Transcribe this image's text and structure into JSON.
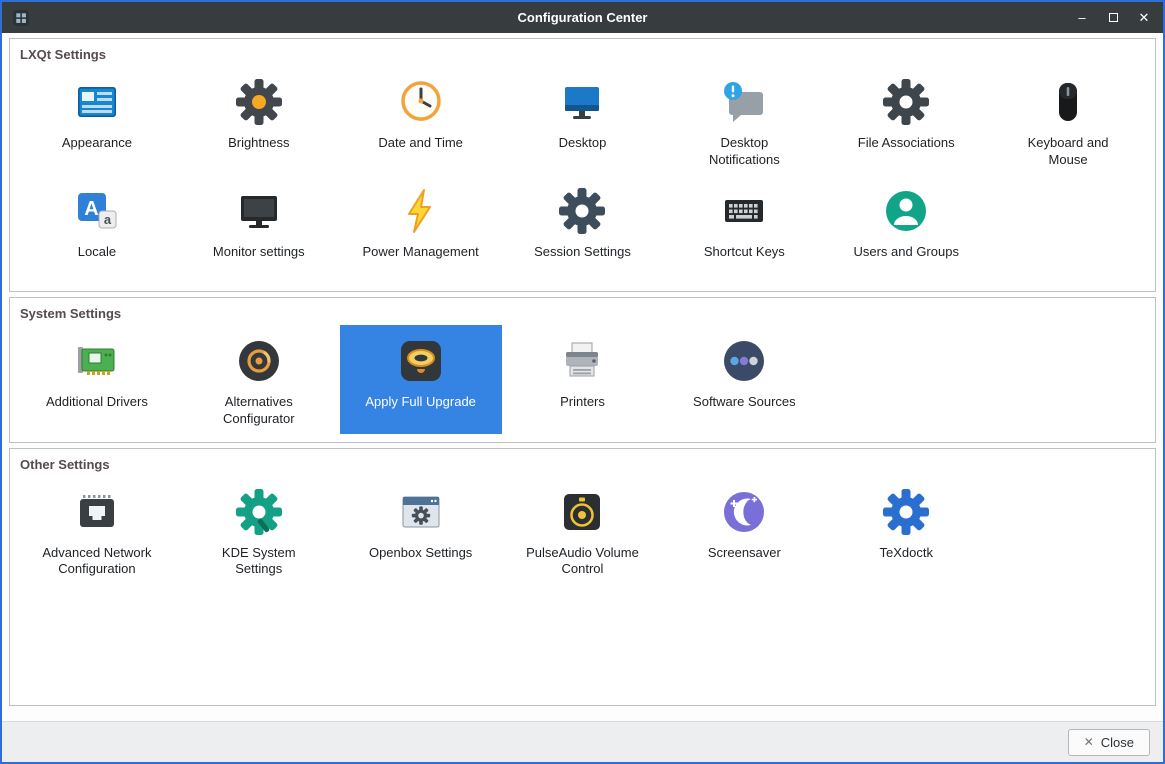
{
  "window": {
    "title": "Configuration Center",
    "border_color": "#2d6fd6",
    "titlebar_bg": "#373c3f",
    "selection_color": "#3584e4"
  },
  "titlebar": {
    "app_icon": "configuration-center-app-icon",
    "minimize_glyph": "–",
    "maximize_glyph": "maximize-box",
    "close_glyph": "✕"
  },
  "sections": [
    {
      "label": "LXQt Settings",
      "items": [
        {
          "label": "Appearance",
          "icon": "appearance-icon"
        },
        {
          "label": "Brightness",
          "icon": "brightness-icon"
        },
        {
          "label": "Date and Time",
          "icon": "date-time-icon"
        },
        {
          "label": "Desktop",
          "icon": "desktop-icon"
        },
        {
          "label": "Desktop Notifications",
          "icon": "desktop-notifications-icon"
        },
        {
          "label": "File Associations",
          "icon": "file-associations-icon"
        },
        {
          "label": "Keyboard and Mouse",
          "icon": "keyboard-mouse-icon"
        },
        {
          "label": "Locale",
          "icon": "locale-icon"
        },
        {
          "label": "Monitor settings",
          "icon": "monitor-settings-icon"
        },
        {
          "label": "Power Management",
          "icon": "power-management-icon"
        },
        {
          "label": "Session Settings",
          "icon": "session-settings-icon"
        },
        {
          "label": "Shortcut Keys",
          "icon": "shortcut-keys-icon"
        },
        {
          "label": "Users and Groups",
          "icon": "users-groups-icon"
        }
      ]
    },
    {
      "label": "System Settings",
      "items": [
        {
          "label": "Additional Drivers",
          "icon": "additional-drivers-icon"
        },
        {
          "label": "Alternatives Configurator",
          "icon": "alternatives-configurator-icon"
        },
        {
          "label": "Apply Full Upgrade",
          "icon": "apply-full-upgrade-icon",
          "selected": true
        },
        {
          "label": "Printers",
          "icon": "printers-icon"
        },
        {
          "label": "Software Sources",
          "icon": "software-sources-icon"
        }
      ]
    },
    {
      "label": "Other Settings",
      "items": [
        {
          "label": "Advanced Network Configuration",
          "icon": "advanced-network-icon"
        },
        {
          "label": "KDE System Settings",
          "icon": "kde-system-settings-icon"
        },
        {
          "label": "Openbox Settings",
          "icon": "openbox-settings-icon"
        },
        {
          "label": "PulseAudio Volume Control",
          "icon": "pulseaudio-icon"
        },
        {
          "label": "Screensaver",
          "icon": "screensaver-icon"
        },
        {
          "label": "TeXdoctk",
          "icon": "texdoctk-icon"
        }
      ]
    }
  ],
  "footer": {
    "close_label": "Close",
    "close_icon": "✕"
  }
}
